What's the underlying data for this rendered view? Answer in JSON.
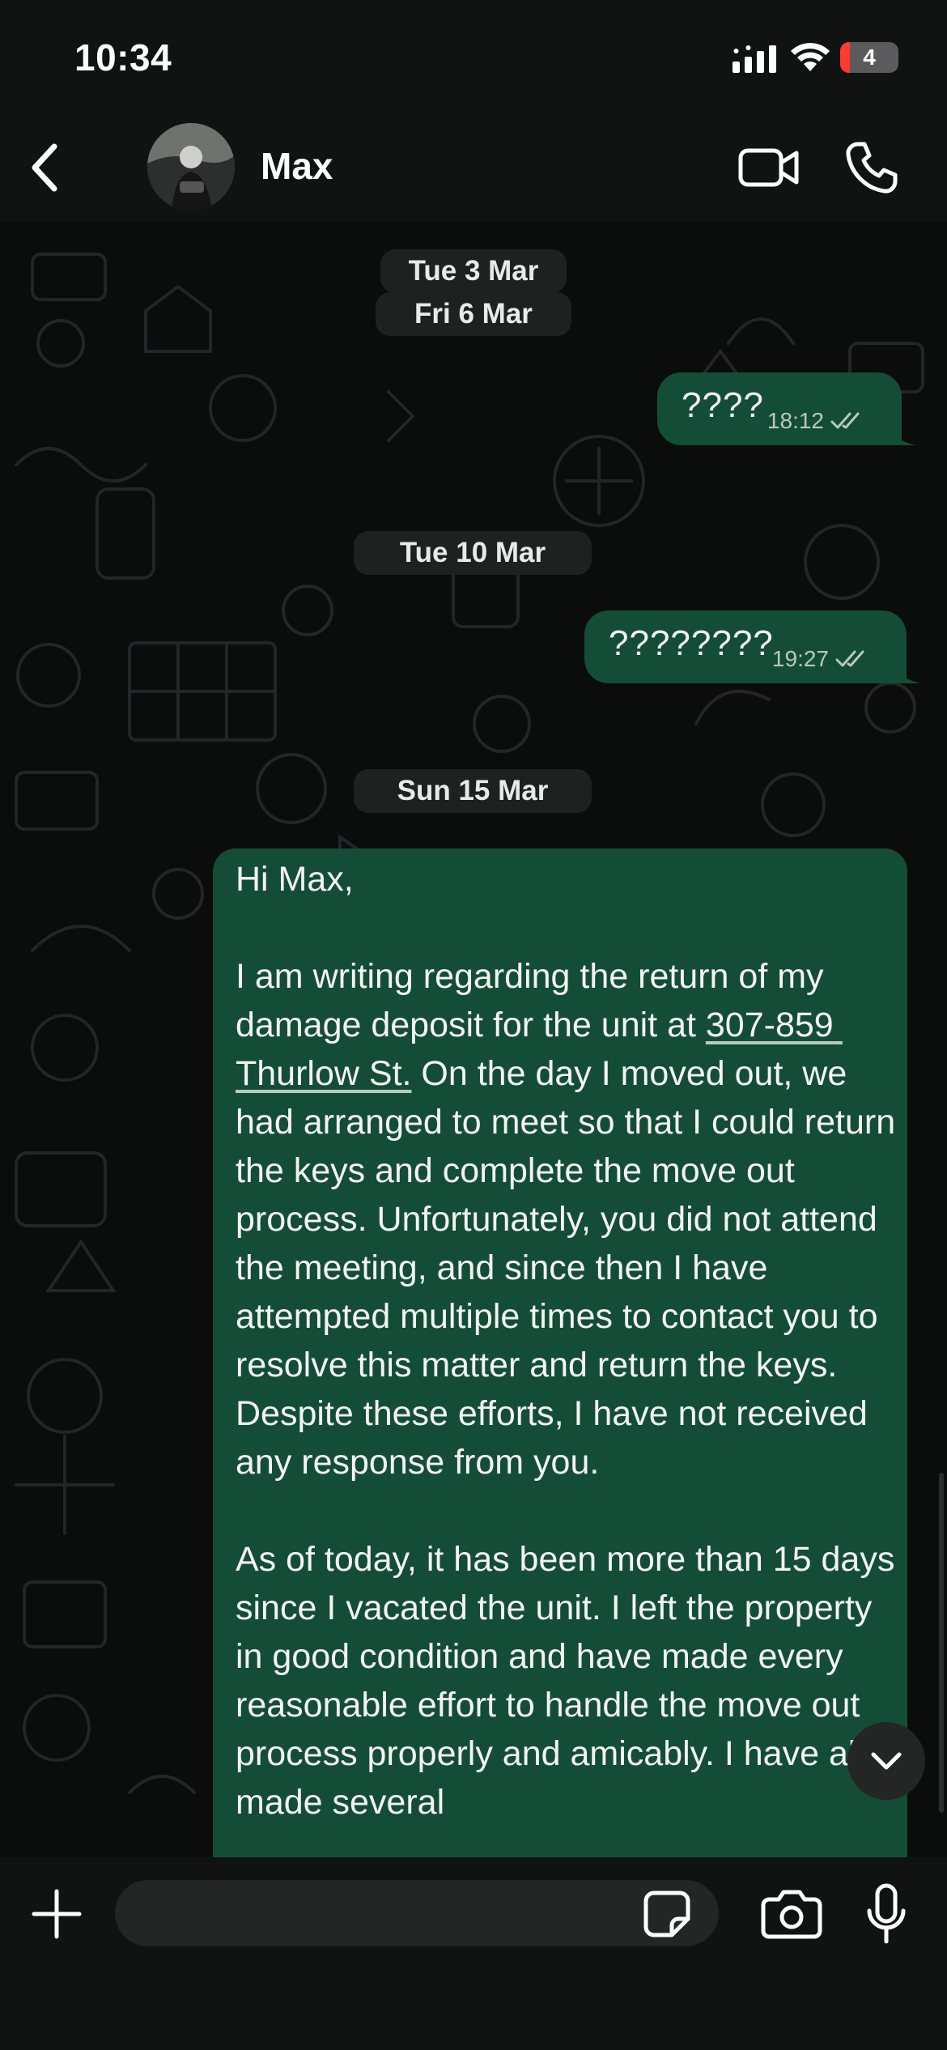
{
  "status_bar": {
    "time": "10:34",
    "battery_level": "4",
    "icons": [
      "signal-icon",
      "wifi-icon",
      "battery-icon"
    ]
  },
  "header": {
    "contact_name": "Max",
    "icons": [
      "chevron-left-icon",
      "video-call-icon",
      "phone-icon"
    ]
  },
  "chat": {
    "date_separators": [
      "Tue 3 Mar",
      "Fri 6 Mar",
      "Tue 10 Mar",
      "Sun 15 Mar"
    ],
    "messages": [
      {
        "text": "????",
        "time": "18:12",
        "status": "read"
      },
      {
        "text": "????????",
        "time": "19:27",
        "status": "read"
      }
    ],
    "long_message": {
      "greeting": "Hi Max,",
      "para1_before": "I am writing regarding the return of my damage deposit for the unit at ",
      "address": "307-859 Thurlow St.",
      "para1_after": " On the day I moved out, we had arranged to meet so that I could return the keys and complete the move out process. Unfortunately, you did not attend the meeting, and since then I have attempted multiple times to contact you to resolve this matter and return the keys. Despite these efforts, I have not received any response from you.",
      "para2": "As of today, it has been more than 15 days since I vacated the unit. I left the property in good condition and have made every reasonable effort to handle the move out process properly and amicably. I have also made several"
    }
  },
  "composer": {
    "placeholder": "",
    "icons": [
      "plus-icon",
      "sticker-icon",
      "camera-icon",
      "microphone-icon"
    ]
  },
  "colors": {
    "outgoing_bubble": "#144d37",
    "background": "#0b0c0c",
    "bar": "#111313"
  }
}
